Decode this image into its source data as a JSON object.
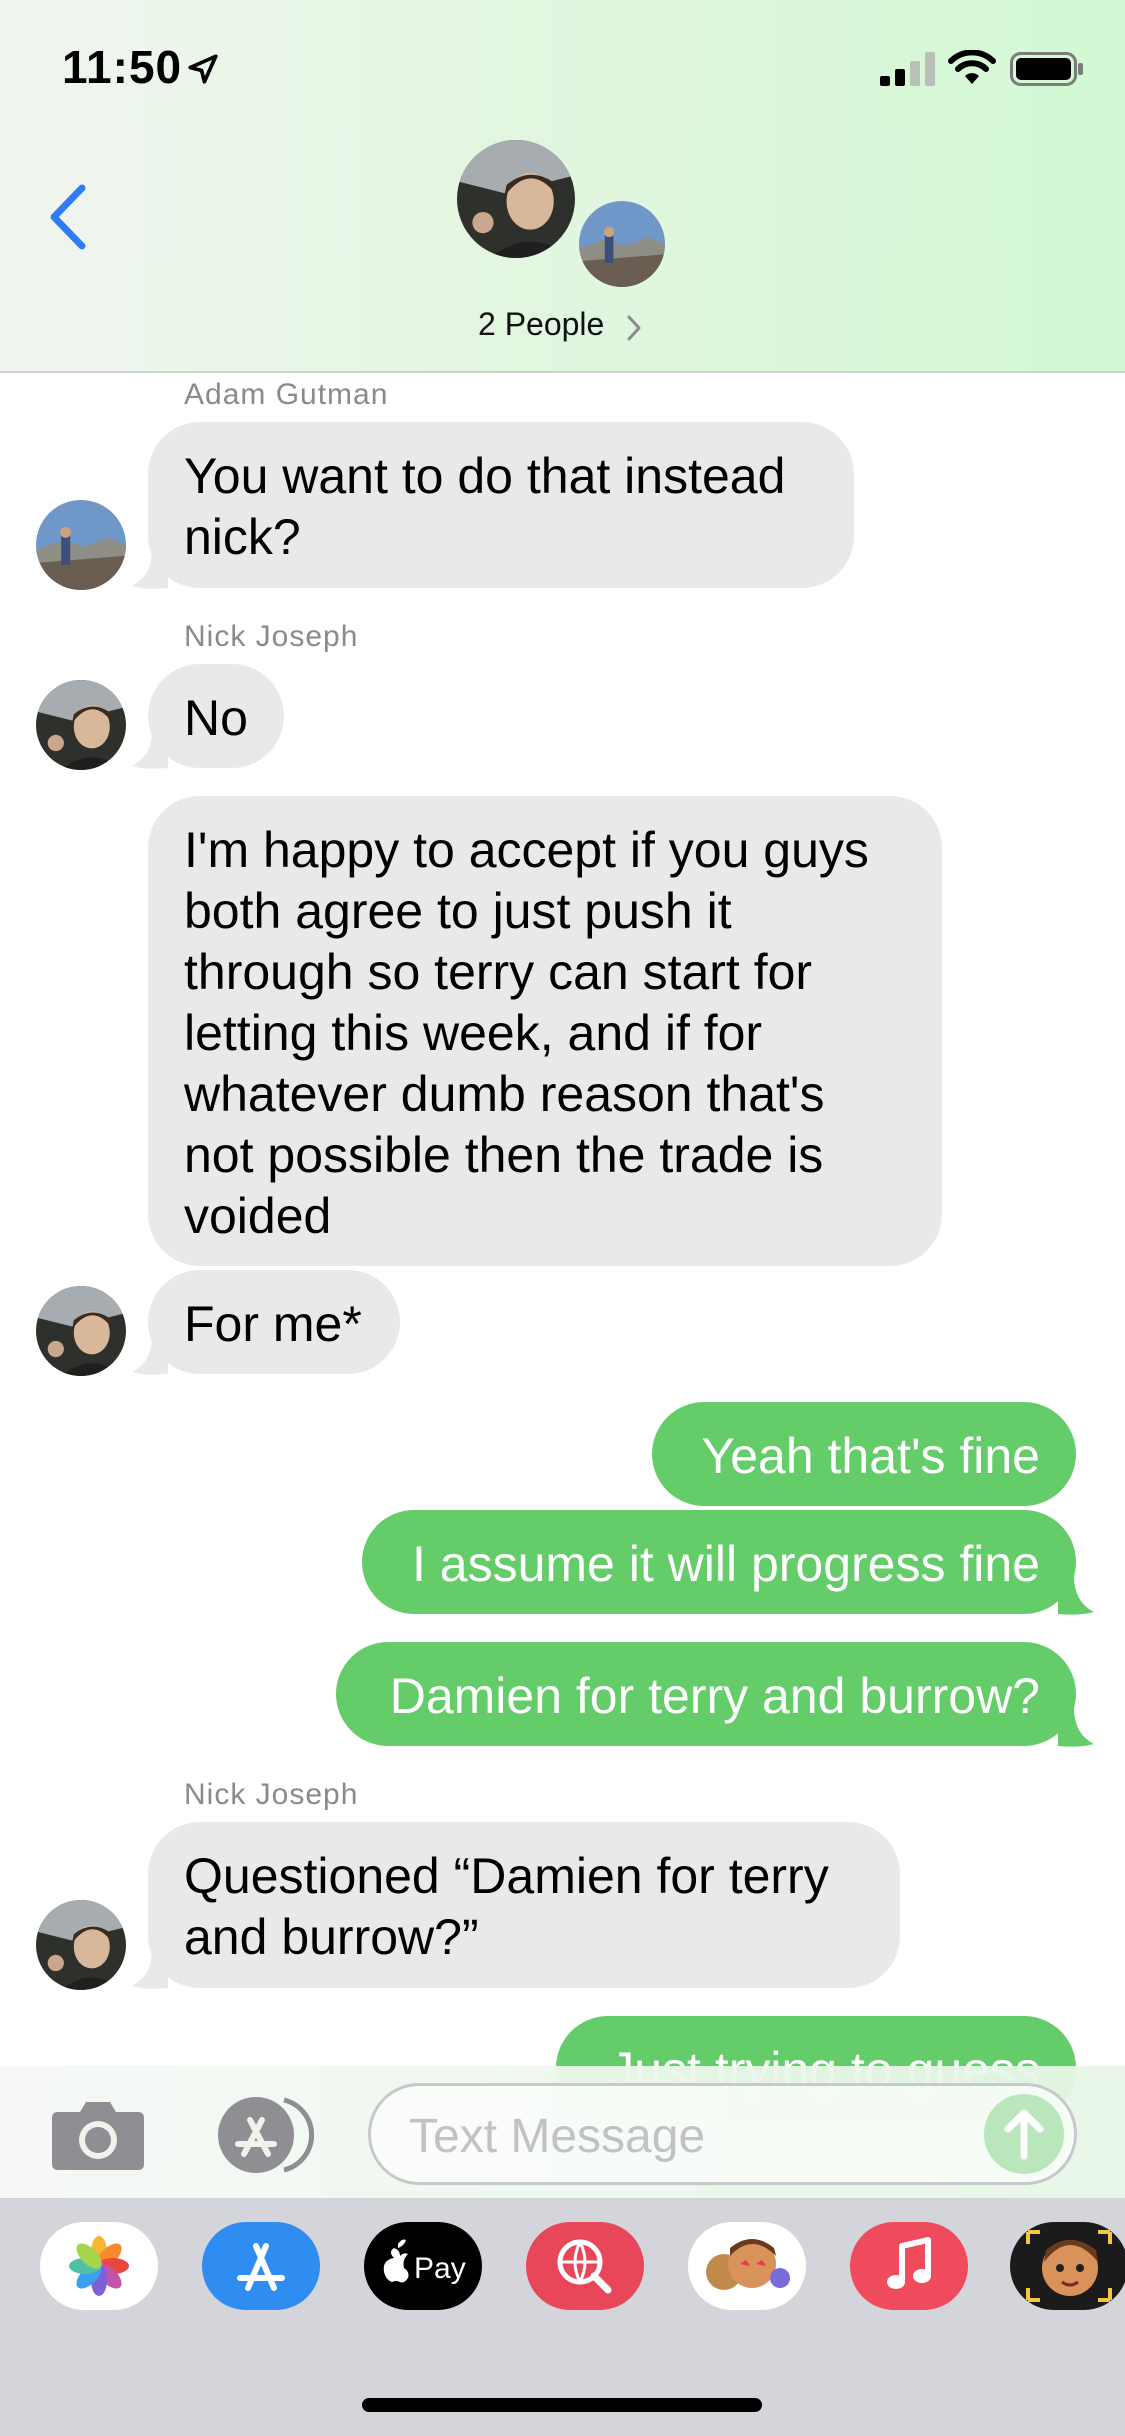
{
  "status_bar": {
    "time": "11:50"
  },
  "header": {
    "people_label": "2 People"
  },
  "messages": [
    {
      "sender": "Adam Gutman",
      "text": "You want to do that instead\nnick?"
    },
    {
      "sender": "Nick Joseph",
      "text": "No"
    },
    {
      "text": "I'm happy to accept if you guys\nboth agree to just push it\nthrough so terry can start for\nletting this week, and if for\nwhatever dumb reason that's\nnot possible then the trade is\nvoided"
    },
    {
      "text": "For me*"
    },
    {
      "text": "Yeah that's fine"
    },
    {
      "text": "I assume it will progress fine"
    },
    {
      "text": "Damien for terry and burrow?"
    },
    {
      "sender": "Nick Joseph",
      "text": "Questioned “Damien for terry\nand burrow?”"
    },
    {
      "text": "Just trying to guess"
    }
  ],
  "input": {
    "placeholder": "Text Message"
  },
  "apps": [
    "photos-icon",
    "app-store-icon",
    "apple-pay-icon",
    "web-images-icon",
    "memoji-stickers-icon",
    "music-icon",
    "memoji-icon"
  ],
  "colors": {
    "outgoing_bubble": "#65cc6a",
    "incoming_bubble": "#e9e9eb",
    "accent": "#2f7cf6"
  }
}
